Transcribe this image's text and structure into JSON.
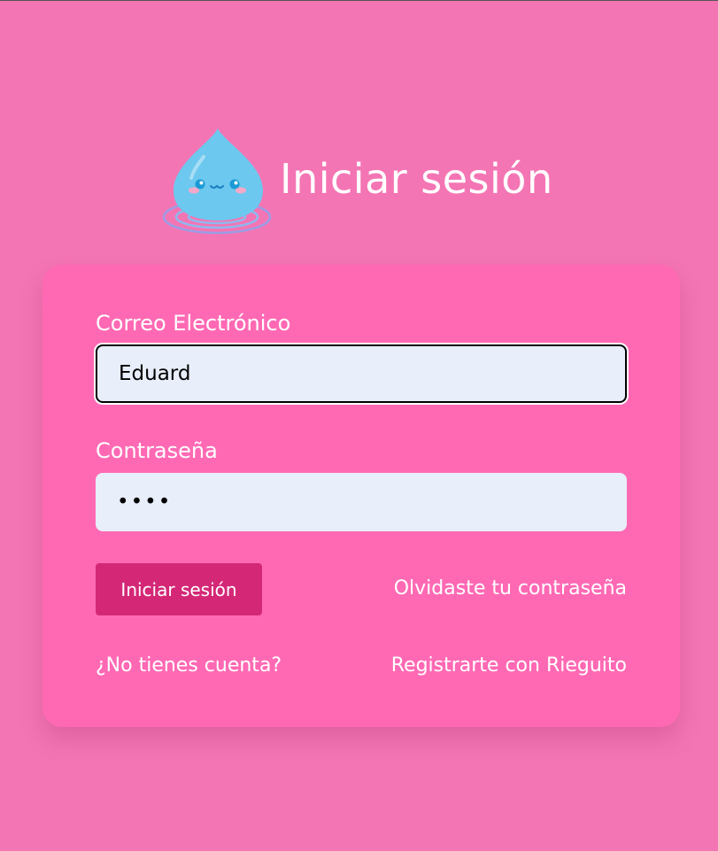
{
  "header": {
    "title": "Iniciar sesión",
    "logo_icon": "water-drop-mascot-icon"
  },
  "form": {
    "email_label": "Correo Electrónico",
    "email_value": "Eduard",
    "password_label": "Contraseña",
    "password_value": "••••",
    "submit_label": "Iniciar sesión",
    "forgot_password_link": "Olvidaste tu contraseña",
    "no_account_text": "¿No tienes cuenta?",
    "register_link": "Registrarte con Rieguito"
  },
  "colors": {
    "page_background": "#f475b4",
    "card_background": "#ff69b4",
    "button_background": "#d42877",
    "input_background": "#e8eefa",
    "drop_color": "#6cc8ee"
  }
}
